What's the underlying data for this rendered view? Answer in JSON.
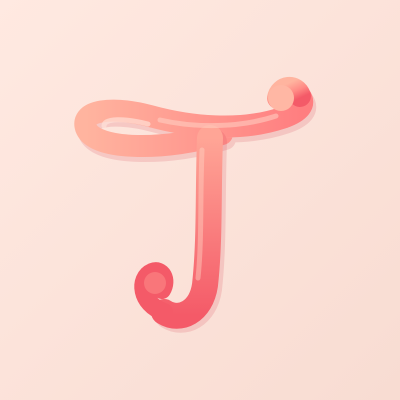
{
  "app_icon": {
    "glyph": "T",
    "icon": "script-letter-t-icon"
  },
  "colors": {
    "background_light": "#FFE9E1",
    "background_dark": "#F8DCD2",
    "letter_light": "#FFB49F",
    "letter_mid": "#FF8A85",
    "letter_dark": "#F45A68",
    "shadow": "#D94A57",
    "highlight": "#FFD2C4"
  }
}
